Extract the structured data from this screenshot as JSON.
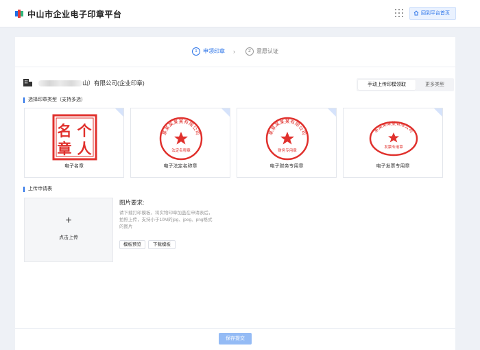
{
  "header": {
    "app_title": "中山市企业电子印章平台",
    "home_button": "回到平台首页",
    "brand_colors": [
      "#1f6fe5",
      "#e23a3a",
      "#2fb77c"
    ]
  },
  "steps": [
    {
      "index": "1",
      "label": "申领印章",
      "active": true
    },
    {
      "index": "2",
      "label": "意愿认证",
      "active": false
    }
  ],
  "company": {
    "name": "山）有限公司(企业印章)",
    "icon": "building-icon"
  },
  "seal_tabs": {
    "manual": "手动上传印模领取",
    "more": "更多类型"
  },
  "seal_section": {
    "title": "选择印章类型（支持多选）",
    "cards": [
      {
        "label": "电子名章",
        "stamp_text": [
          "名",
          "个",
          "章",
          "人"
        ]
      },
      {
        "label": "电子法定名称章",
        "stamp_ring": "某某某某某有限公司",
        "stamp_bottom": "法定名称章"
      },
      {
        "label": "电子财务专用章",
        "stamp_ring": "某某某某某有限公司",
        "stamp_bottom": "财务专用章"
      },
      {
        "label": "电子发票专用章",
        "stamp_ring": "某某某某某有限公司",
        "stamp_bottom": "发票专用章"
      }
    ]
  },
  "upload_section": {
    "title": "上传申请表",
    "box_plus": "+",
    "box_text": "点击上传",
    "req_title": "图片要求:",
    "req_lines": [
      "请下载打印模板，将实物印章加盖在申请表后，",
      "拍照上传，支持小于10M的jpg、jpeg、png格式",
      "的图片"
    ],
    "preview_button": "模板预览",
    "download_button": "下载模板"
  },
  "footer": {
    "save_button": "保存提交"
  },
  "accent_color": "#2a73e8",
  "stamp_color": "#e0302c"
}
